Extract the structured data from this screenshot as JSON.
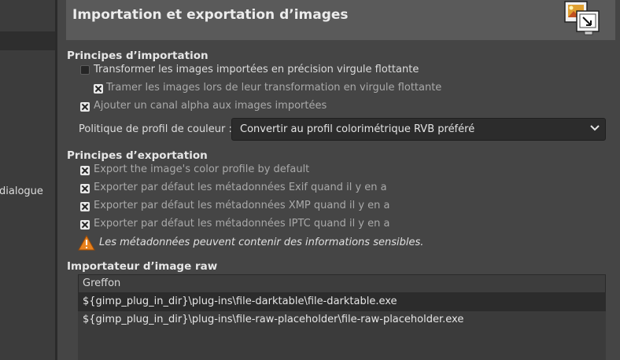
{
  "sidebar": {
    "partial_label": "dialogue"
  },
  "header": {
    "title": "Importation et exportation d’images",
    "icon": "image-import-export-icon"
  },
  "import": {
    "title": "Principes d’importation",
    "options": [
      {
        "label": "Transformer les images importées en précision virgule flottante",
        "checked": false
      },
      {
        "label": "Tramer les images lors de leur transformation en virgule flottante",
        "checked": true
      },
      {
        "label": "Ajouter un canal alpha aux images importées",
        "checked": true
      }
    ],
    "color_profile_label": "Politique de profil de couleur :",
    "color_profile_value": "Convertir au profil colorimétrique RVB préféré"
  },
  "export": {
    "title": "Principes d’exportation",
    "options": [
      {
        "label": "Export the image's color profile by default",
        "checked": true
      },
      {
        "label": "Exporter par défaut les métadonnées Exif quand il y en a",
        "checked": true
      },
      {
        "label": "Exporter par défaut les métadonnées XMP quand il y en a",
        "checked": true
      },
      {
        "label": "Exporter par défaut les métadonnées IPTC quand il y en a",
        "checked": true
      }
    ],
    "warning": "Les métadonnées peuvent contenir des informations sensibles."
  },
  "raw": {
    "title": "Importateur d’image raw",
    "column_header": "Greffon",
    "rows": [
      "${gimp_plug_in_dir}\\plug-ins\\file-darktable\\file-darktable.exe",
      "${gimp_plug_in_dir}\\plug-ins\\file-raw-placeholder\\file-raw-placeholder.exe"
    ],
    "selected_index": 0
  }
}
